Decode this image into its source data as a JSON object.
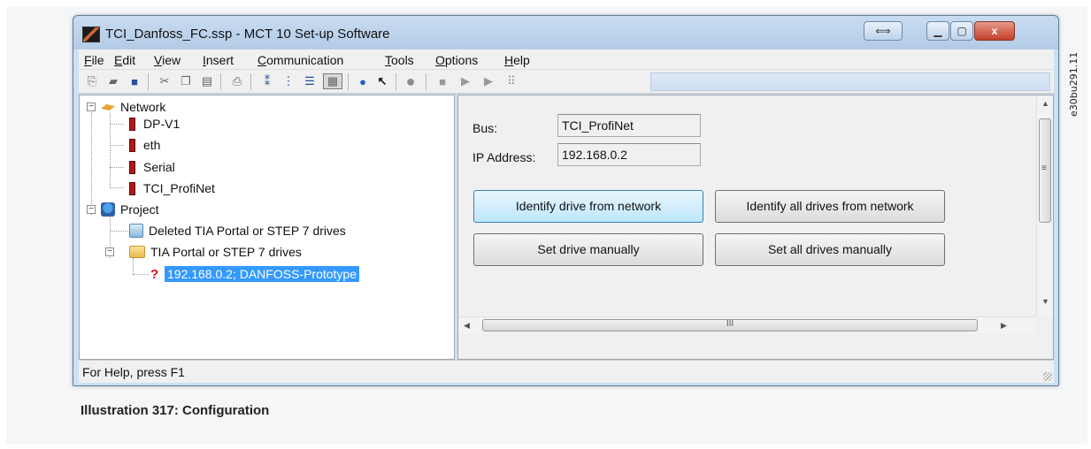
{
  "side_code": "e30bu291.11",
  "window": {
    "title": "TCI_Danfoss_FC.ssp - MCT 10 Set-up Software",
    "controls": [
      "restore-icon",
      "minimize-icon",
      "maximize-icon",
      "close-icon"
    ],
    "close_glyph": "x"
  },
  "menu": {
    "items": [
      {
        "key": "F",
        "rest": "ile"
      },
      {
        "key": "E",
        "rest": "dit"
      },
      {
        "key": "V",
        "rest": "iew"
      },
      {
        "key": "I",
        "rest": "nsert"
      },
      {
        "key": "C",
        "rest": "ommunication"
      },
      {
        "key": "T",
        "rest": "ools"
      },
      {
        "key": "O",
        "rest": "ptions"
      },
      {
        "key": "H",
        "rest": "elp"
      }
    ]
  },
  "toolbar": {
    "icons": [
      "new-icon",
      "open-icon",
      "save-icon",
      "cut-icon",
      "copy-icon",
      "paste-icon",
      "print-icon",
      "large-icons-icon",
      "list-icon",
      "details-icon",
      "grid-view-icon",
      "help-icon",
      "context-help-icon",
      "record-icon",
      "stop-icon",
      "play-icon",
      "step-icon",
      "scan-icon"
    ]
  },
  "tree": {
    "network_label": "Network",
    "buses": [
      "DP-V1",
      "eth",
      "Serial",
      "TCI_ProfiNet"
    ],
    "project_label": "Project",
    "deleted_label": "Deleted TIA Portal or STEP 7 drives",
    "tia_label": "TIA Portal or STEP 7 drives",
    "drive_label": "192.168.0.2; DANFOSS-Prototype",
    "drive_marker": "?"
  },
  "details": {
    "bus_label": "Bus:",
    "bus_value": "TCI_ProfiNet",
    "ip_label": "IP Address:",
    "ip_value": "192.168.0.2",
    "identify_drive": "Identify drive from network",
    "identify_all": "Identify all drives from network",
    "set_manual": "Set drive manually",
    "set_all_manual": "Set all drives manually",
    "hscroll_grip": "III",
    "vscroll_grip": "≡"
  },
  "status": {
    "text": "For Help, press F1"
  },
  "caption": "Illustration 317: Configuration"
}
